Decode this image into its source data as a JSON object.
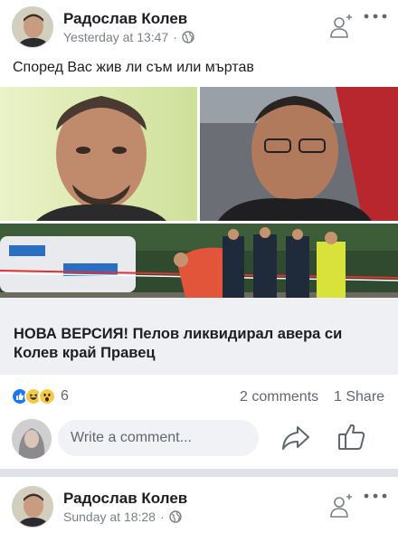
{
  "post": {
    "author": "Радослав Колев",
    "timestamp": "Yesterday at 13:47",
    "privacy_icon": "globe-icon",
    "text": "Според Вас жив ли съм или мъртав",
    "link_title": "НОВА ВЕРСИЯ! Пелов ликвидирал авера си Колев край Правец",
    "reaction_count": "6",
    "comments": "2 comments",
    "shares": "1 Share",
    "comment_placeholder": "Write a comment..."
  },
  "post2": {
    "author": "Радослав Колев",
    "timestamp": "Sunday at 18:28",
    "privacy_icon": "globe-icon"
  },
  "colors": {
    "like_blue": "#1877f2",
    "haha_yellow": "#f7c94a",
    "divider": "#dfe3e8",
    "link_bg": "#eef0f3"
  }
}
